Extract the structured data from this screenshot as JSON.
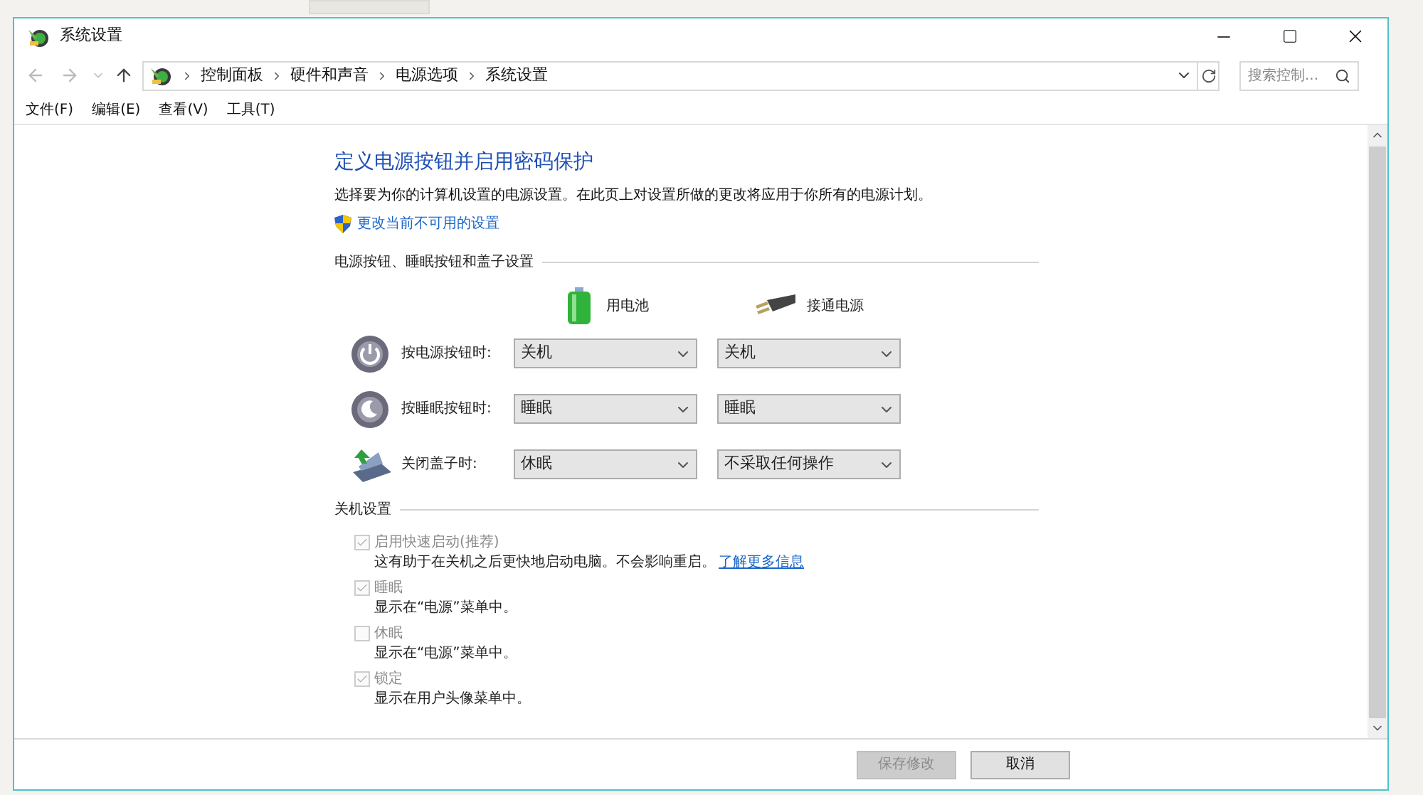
{
  "window": {
    "title": "系统设置"
  },
  "address_bar": {
    "breadcrumbs": [
      "控制面板",
      "硬件和声音",
      "电源选项",
      "系统设置"
    ]
  },
  "search": {
    "placeholder": "搜索控制..."
  },
  "menu": [
    "文件(F)",
    "编辑(E)",
    "查看(V)",
    "工具(T)"
  ],
  "heading": "定义电源按钮并启用密码保护",
  "description": "选择要为你的计算机设置的电源设置。在此页上对设置所做的更改将应用于你所有的电源计划。",
  "admin_link": "更改当前不可用的设置",
  "buttons_section": {
    "title": "电源按钮、睡眠按钮和盖子设置",
    "columns": [
      {
        "kind": "battery",
        "label": "用电池"
      },
      {
        "kind": "plug",
        "label": "接通电源"
      }
    ],
    "rows": [
      {
        "kind": "power",
        "label": "按电源按钮时:",
        "values": [
          "关机",
          "关机"
        ]
      },
      {
        "kind": "sleep",
        "label": "按睡眠按钮时:",
        "values": [
          "睡眠",
          "睡眠"
        ]
      },
      {
        "kind": "lid",
        "label": "关闭盖子时:",
        "values": [
          "休眠",
          "不采取任何操作"
        ]
      }
    ]
  },
  "shutdown_section": {
    "title": "关机设置",
    "options": [
      {
        "label": "启用快速启动(推荐)",
        "checked": true,
        "disabled": true,
        "description": "这有助于在关机之后更快地启动电脑。不会影响重启。",
        "link": "了解更多信息"
      },
      {
        "label": "睡眠",
        "checked": true,
        "disabled": true,
        "description": "显示在“电源”菜单中。"
      },
      {
        "label": "休眠",
        "checked": false,
        "disabled": true,
        "description": "显示在“电源”菜单中。"
      },
      {
        "label": "锁定",
        "checked": true,
        "disabled": true,
        "description": "显示在用户头像菜单中。"
      }
    ]
  },
  "footer_buttons": [
    {
      "label": "保存修改",
      "disabled": true
    },
    {
      "label": "取消",
      "disabled": false
    }
  ]
}
